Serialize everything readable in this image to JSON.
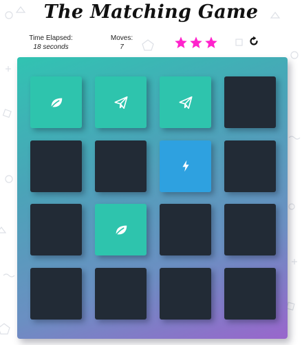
{
  "title": "The Matching Game",
  "stats": {
    "time_label": "Time Elapsed:",
    "time_value": "18 seconds",
    "moves_label": "Moves:",
    "moves_value": "7"
  },
  "rating": {
    "stars_shown": 3,
    "star_color": "#ff22cc"
  },
  "restart": {
    "icon": "restart-icon"
  },
  "colors": {
    "card_hidden": "#222b36",
    "card_match": "#2ec4ad",
    "card_open": "#2ea1e0",
    "deck_gradient_start": "#31c3b2",
    "deck_gradient_end": "#9966cc"
  },
  "deck": {
    "rows": [
      [
        {
          "state": "match",
          "icon": "leaf-icon"
        },
        {
          "state": "match",
          "icon": "paper-plane-icon"
        },
        {
          "state": "match",
          "icon": "paper-plane-icon"
        },
        {
          "state": "hidden",
          "icon": ""
        }
      ],
      [
        {
          "state": "hidden",
          "icon": ""
        },
        {
          "state": "hidden",
          "icon": ""
        },
        {
          "state": "open",
          "icon": "bolt-icon"
        },
        {
          "state": "hidden",
          "icon": ""
        }
      ],
      [
        {
          "state": "hidden",
          "icon": ""
        },
        {
          "state": "match",
          "icon": "leaf-icon"
        },
        {
          "state": "hidden",
          "icon": ""
        },
        {
          "state": "hidden",
          "icon": ""
        }
      ],
      [
        {
          "state": "hidden",
          "icon": ""
        },
        {
          "state": "hidden",
          "icon": ""
        },
        {
          "state": "hidden",
          "icon": ""
        },
        {
          "state": "hidden",
          "icon": ""
        }
      ]
    ]
  }
}
